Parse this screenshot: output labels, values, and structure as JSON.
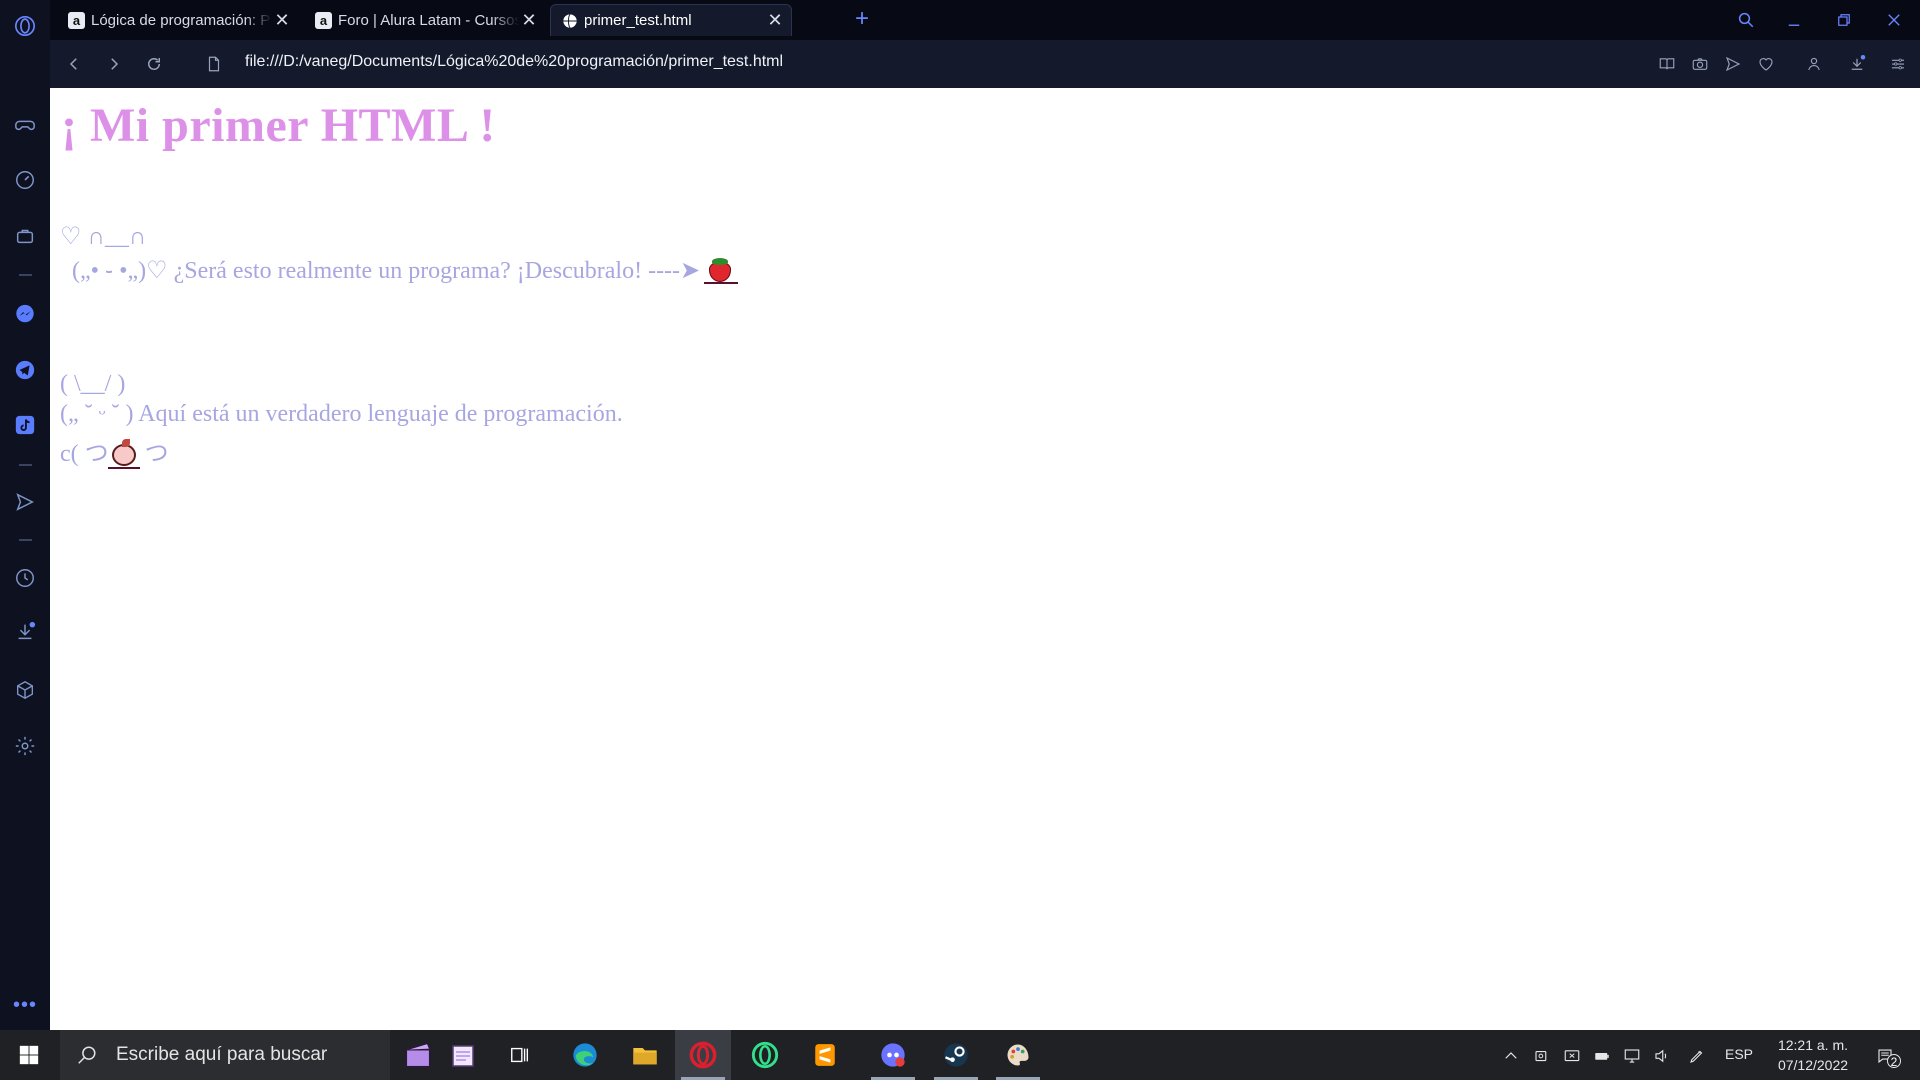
{
  "browser": {
    "tabs": [
      {
        "label": "Lógica de programación: Pa",
        "favicon": "a"
      },
      {
        "label": "Foro | Alura Latam - Cursos",
        "favicon": "a"
      },
      {
        "label": "primer_test.html",
        "favicon": "globe"
      }
    ],
    "active_tab": 2,
    "url": "file:///D:/vaneg/Documents/Lógica%20de%20programación/primer_test.html",
    "accent": "#6a86ff"
  },
  "page": {
    "heading": "¡ Mi primer HTML !",
    "heading_color": "#dd90e7",
    "text_color": "#a6a6e1",
    "art1_line1": "♡ ∩__∩",
    "art1_line2": "  („• ֊ •„)♡ ¿Será esto realmente un programa? ¡Descubralo! ----➤",
    "art2_line1": "( \\__/ )",
    "art2_line2": "(„ ˘ ᵕ ˘ ) Aquí está un verdadero lenguaje de programación.",
    "art2_line3_a": "c( つ",
    "art2_line3_b": " つ"
  },
  "taskbar": {
    "search_placeholder": "Escribe aquí para buscar",
    "language": "ESP",
    "time": "12:21 a. m.",
    "date": "07/12/2022",
    "notifications": "2"
  }
}
